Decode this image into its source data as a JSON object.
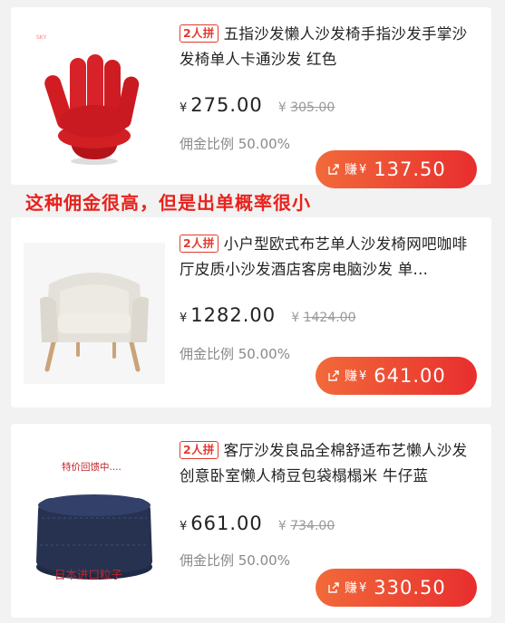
{
  "annotation": "这种佣金很高，但是出单概率很小",
  "products": [
    {
      "tag": "2人拼",
      "title": "五指沙发懒人沙发椅手指沙发手掌沙发椅单人卡通沙发 红色",
      "yen": "¥",
      "price": "275.00",
      "orig_yen": "¥",
      "orig_price": "305.00",
      "commission": "佣金比例 50.00%",
      "earn_label": "赚",
      "earn_yen": "¥",
      "earn_value": "137.50",
      "img_label": "SKY"
    },
    {
      "tag": "2人拼",
      "title": "小户型欧式布艺单人沙发椅网吧咖啡厅皮质小沙发酒店客房电脑沙发 单...",
      "yen": "¥",
      "price": "1282.00",
      "orig_yen": "¥",
      "orig_price": "1424.00",
      "commission": "佣金比例 50.00%",
      "earn_label": "赚",
      "earn_yen": "¥",
      "earn_value": "641.00"
    },
    {
      "tag": "2人拼",
      "title": "客厅沙发良品全棉舒适布艺懒人沙发 创意卧室懒人椅豆包袋榻榻米 牛仔蓝",
      "yen": "¥",
      "price": "661.00",
      "orig_yen": "¥",
      "orig_price": "734.00",
      "commission": "佣金比例 50.00%",
      "earn_label": "赚",
      "earn_yen": "¥",
      "earn_value": "330.50",
      "img_caption_top": "特价回馈中....",
      "img_caption_bottom": "日本进口粒子"
    }
  ],
  "colors": {
    "accent": "#e82e2e",
    "accent_start": "#f26a3a",
    "annotation": "#e8221c"
  },
  "icons": {
    "earn_button": "share-icon"
  }
}
